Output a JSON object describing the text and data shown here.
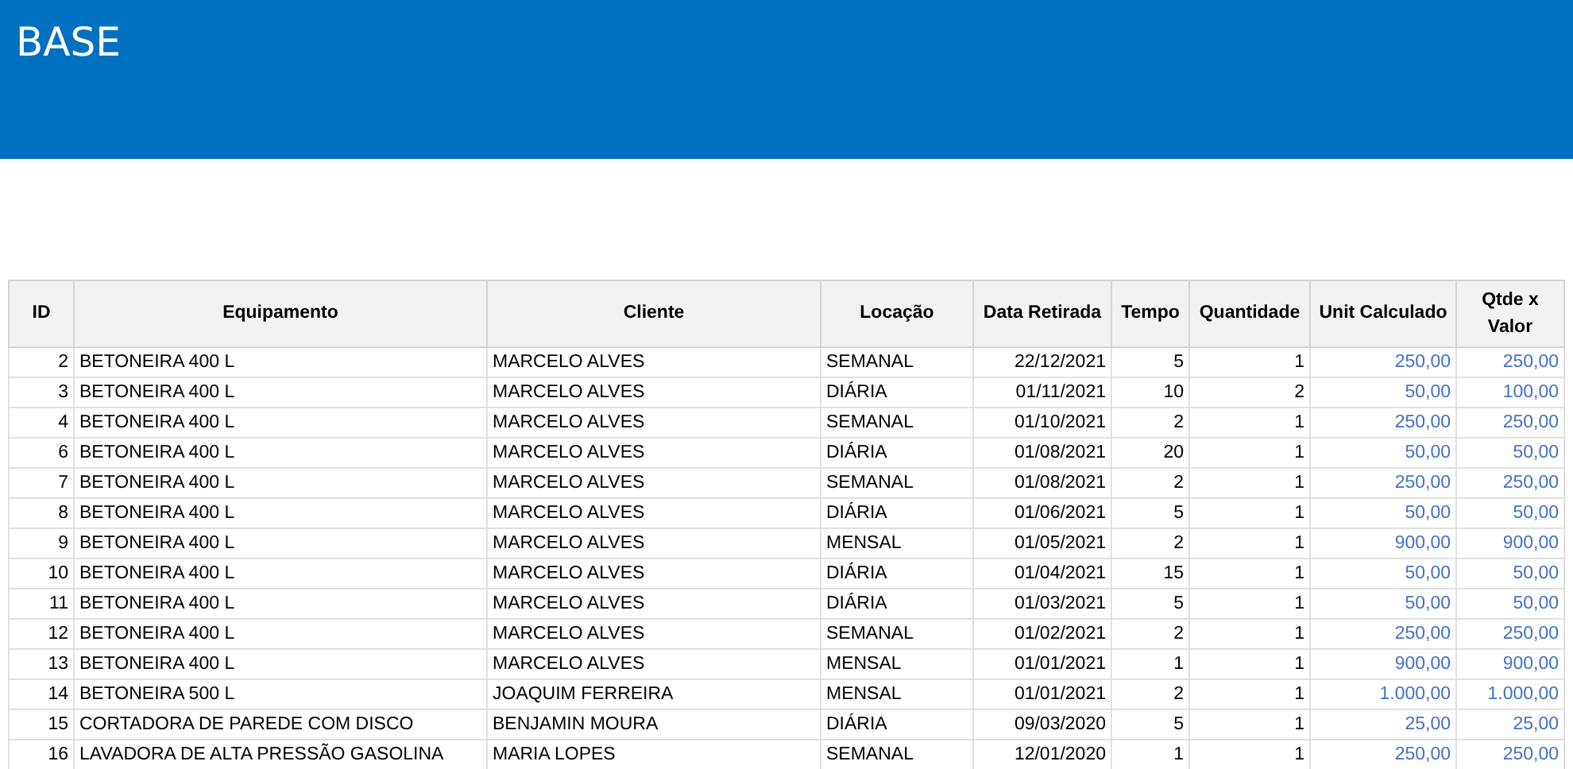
{
  "banner": {
    "title": "BASE"
  },
  "table": {
    "columns": [
      "ID",
      "Equipamento",
      "Cliente",
      "Locação",
      "Data Retirada",
      "Tempo",
      "Quantidade",
      "Unit Calculado",
      "Qtde x Valor"
    ],
    "rows": [
      [
        "2",
        "BETONEIRA 400 L",
        "MARCELO ALVES",
        "SEMANAL",
        "22/12/2021",
        "5",
        "1",
        "250,00",
        "250,00"
      ],
      [
        "3",
        "BETONEIRA 400 L",
        "MARCELO ALVES",
        "DIÁRIA",
        "01/11/2021",
        "10",
        "2",
        "50,00",
        "100,00"
      ],
      [
        "4",
        "BETONEIRA 400 L",
        "MARCELO ALVES",
        "SEMANAL",
        "01/10/2021",
        "2",
        "1",
        "250,00",
        "250,00"
      ],
      [
        "6",
        "BETONEIRA 400 L",
        "MARCELO ALVES",
        "DIÁRIA",
        "01/08/2021",
        "20",
        "1",
        "50,00",
        "50,00"
      ],
      [
        "7",
        "BETONEIRA 400 L",
        "MARCELO ALVES",
        "SEMANAL",
        "01/08/2021",
        "2",
        "1",
        "250,00",
        "250,00"
      ],
      [
        "8",
        "BETONEIRA 400 L",
        "MARCELO ALVES",
        "DIÁRIA",
        "01/06/2021",
        "5",
        "1",
        "50,00",
        "50,00"
      ],
      [
        "9",
        "BETONEIRA 400 L",
        "MARCELO ALVES",
        "MENSAL",
        "01/05/2021",
        "2",
        "1",
        "900,00",
        "900,00"
      ],
      [
        "10",
        "BETONEIRA 400 L",
        "MARCELO ALVES",
        "DIÁRIA",
        "01/04/2021",
        "15",
        "1",
        "50,00",
        "50,00"
      ],
      [
        "11",
        "BETONEIRA 400 L",
        "MARCELO ALVES",
        "DIÁRIA",
        "01/03/2021",
        "5",
        "1",
        "50,00",
        "50,00"
      ],
      [
        "12",
        "BETONEIRA 400 L",
        "MARCELO ALVES",
        "SEMANAL",
        "01/02/2021",
        "2",
        "1",
        "250,00",
        "250,00"
      ],
      [
        "13",
        "BETONEIRA 400 L",
        "MARCELO ALVES",
        "MENSAL",
        "01/01/2021",
        "1",
        "1",
        "900,00",
        "900,00"
      ],
      [
        "14",
        "BETONEIRA 500 L",
        "JOAQUIM FERREIRA",
        "MENSAL",
        "01/01/2021",
        "2",
        "1",
        "1.000,00",
        "1.000,00"
      ],
      [
        "15",
        "CORTADORA DE PAREDE COM DISCO",
        "BENJAMIN MOURA",
        "DIÁRIA",
        "09/03/2020",
        "5",
        "1",
        "25,00",
        "25,00"
      ],
      [
        "16",
        "LAVADORA DE ALTA PRESSÃO GASOLINA",
        "MARIA LOPES",
        "SEMANAL",
        "12/01/2020",
        "1",
        "1",
        "250,00",
        "250,00"
      ]
    ]
  }
}
